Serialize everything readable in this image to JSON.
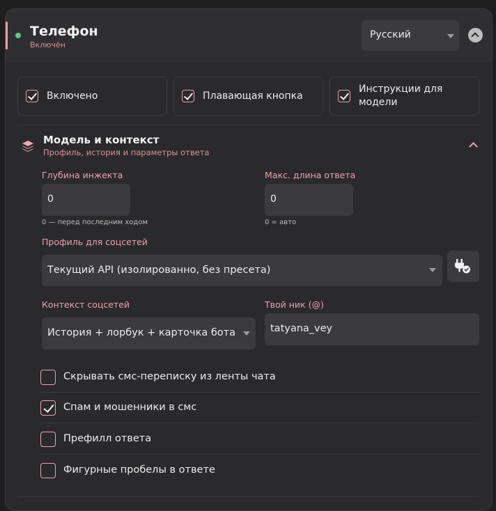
{
  "header": {
    "title": "Телефон",
    "status": "Включён",
    "language": "Русский",
    "status_color": "#5cc98a",
    "accent_color": "#e9a3ad"
  },
  "toggles": [
    {
      "label": "Включено",
      "checked": true
    },
    {
      "label": "Плавающая кнопка",
      "checked": true
    },
    {
      "label_line1": "Инструкции для",
      "label_line2": "модели",
      "checked": true
    }
  ],
  "section": {
    "icon": "layers-icon",
    "title": "Модель и контекст",
    "subtitle": "Профиль, история и параметры ответа"
  },
  "fields": {
    "injection_depth": {
      "label": "Глубина инжекта",
      "value": "0",
      "hint": "0 — перед последним ходом"
    },
    "max_length": {
      "label": "Макс. длина ответа",
      "value": "0",
      "hint": "0 = авто"
    },
    "social_profile": {
      "label": "Профиль для соцсетей",
      "value": "Текущий API (изолированно, без пресета)"
    },
    "social_context": {
      "label": "Контекст соцсетей",
      "value": "История + лорбук + карточка бота"
    },
    "nickname": {
      "label": "Твой ник (@)",
      "value": "tatyana_vey"
    }
  },
  "options": [
    {
      "label": "Скрывать смс-переписку из ленты чата",
      "checked": false
    },
    {
      "label": "Спам и мошенники в смс",
      "checked": true
    },
    {
      "label": "Префилл ответа",
      "checked": false
    },
    {
      "label": "Фигурные пробелы в ответе",
      "checked": false
    }
  ]
}
